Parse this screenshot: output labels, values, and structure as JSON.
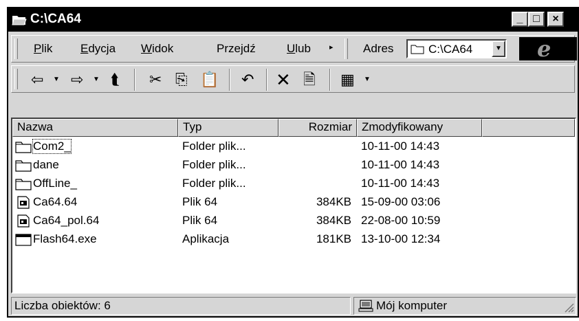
{
  "window": {
    "title": "C:\\CA64",
    "icon": "folder-open-icon"
  },
  "title_buttons": {
    "minimize": "_",
    "maximize": "□",
    "close": "×"
  },
  "menu": {
    "items": [
      {
        "label_ul": "P",
        "label_rest": "lik"
      },
      {
        "label_ul": "E",
        "label_rest": "dycja"
      },
      {
        "label_ul": "W",
        "label_rest": "idok"
      },
      {
        "label_pre": "Prze",
        "label_ul": "j",
        "label_post": "dź"
      },
      {
        "label_ul": "U",
        "label_rest": "lub"
      }
    ],
    "more_arrow": "▸"
  },
  "address": {
    "label": "Adres",
    "value": "C:\\CA64",
    "drop_arrow": "▼"
  },
  "toolbar": {
    "back": "⇦",
    "forward": "⇨",
    "up": "⮬",
    "cut": "✂",
    "copy": "⎘",
    "paste": "📋",
    "undo": "↶",
    "delete": "✕",
    "properties": "🗎",
    "views": "▦",
    "drop": "▼"
  },
  "columns": {
    "name": "Nazwa",
    "type": "Typ",
    "size": "Rozmiar",
    "modified": "Zmodyfikowany"
  },
  "files": [
    {
      "name": "Com2_",
      "type": "Folder plik...",
      "size": "",
      "modified": "10-11-00 14:43",
      "icon": "folder-icon"
    },
    {
      "name": "dane",
      "type": "Folder plik...",
      "size": "",
      "modified": "10-11-00 14:43",
      "icon": "folder-icon"
    },
    {
      "name": "OffLine_",
      "type": "Folder plik...",
      "size": "",
      "modified": "10-11-00 14:43",
      "icon": "folder-icon"
    },
    {
      "name": "Ca64.64",
      "type": "Plik 64",
      "size": "384KB",
      "modified": "15-09-00 03:06",
      "icon": "file-64-icon"
    },
    {
      "name": "Ca64_pol.64",
      "type": "Plik 64",
      "size": "384KB",
      "modified": "22-08-00 10:59",
      "icon": "file-64-icon"
    },
    {
      "name": "Flash64.exe",
      "type": "Aplikacja",
      "size": "181KB",
      "modified": "13-10-00 12:34",
      "icon": "application-icon"
    }
  ],
  "status": {
    "count": "Liczba obiektów: 6",
    "location": "Mój komputer",
    "location_icon": "computer-icon"
  },
  "colors": {
    "titlebar": "#000000",
    "face": "#d6d6d6",
    "window_bg": "#ffffff"
  }
}
